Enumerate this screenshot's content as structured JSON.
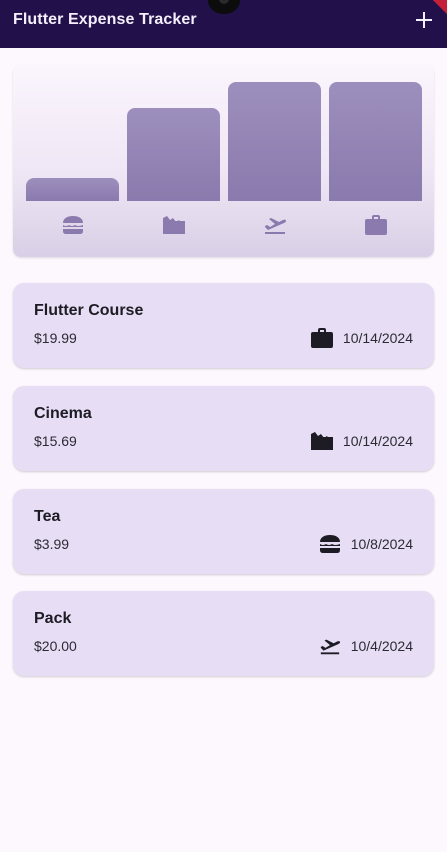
{
  "appbar": {
    "title": "Flutter Expense Tracker",
    "add_icon": "plus-icon",
    "background": "#22104a"
  },
  "chart": {
    "bar_color": "#8a7aad",
    "buckets": [
      {
        "category": "food",
        "icon": "burger-icon",
        "relative_value": 0.19
      },
      {
        "category": "leisure",
        "icon": "clapperboard-icon",
        "relative_value": 0.78
      },
      {
        "category": "travel",
        "icon": "flight-takeoff-icon",
        "relative_value": 1.0
      },
      {
        "category": "work",
        "icon": "briefcase-icon",
        "relative_value": 1.0
      }
    ]
  },
  "expenses": [
    {
      "title": "Flutter Course",
      "amount": "$19.99",
      "category_icon": "briefcase-icon",
      "date": "10/14/2024"
    },
    {
      "title": "Cinema",
      "amount": "$15.69",
      "category_icon": "clapperboard-icon",
      "date": "10/14/2024"
    },
    {
      "title": "Tea",
      "amount": "$3.99",
      "category_icon": "burger-icon",
      "date": "10/8/2024"
    },
    {
      "title": "Pack",
      "amount": "$20.00",
      "category_icon": "flight-takeoff-icon",
      "date": "10/4/2024"
    }
  ]
}
